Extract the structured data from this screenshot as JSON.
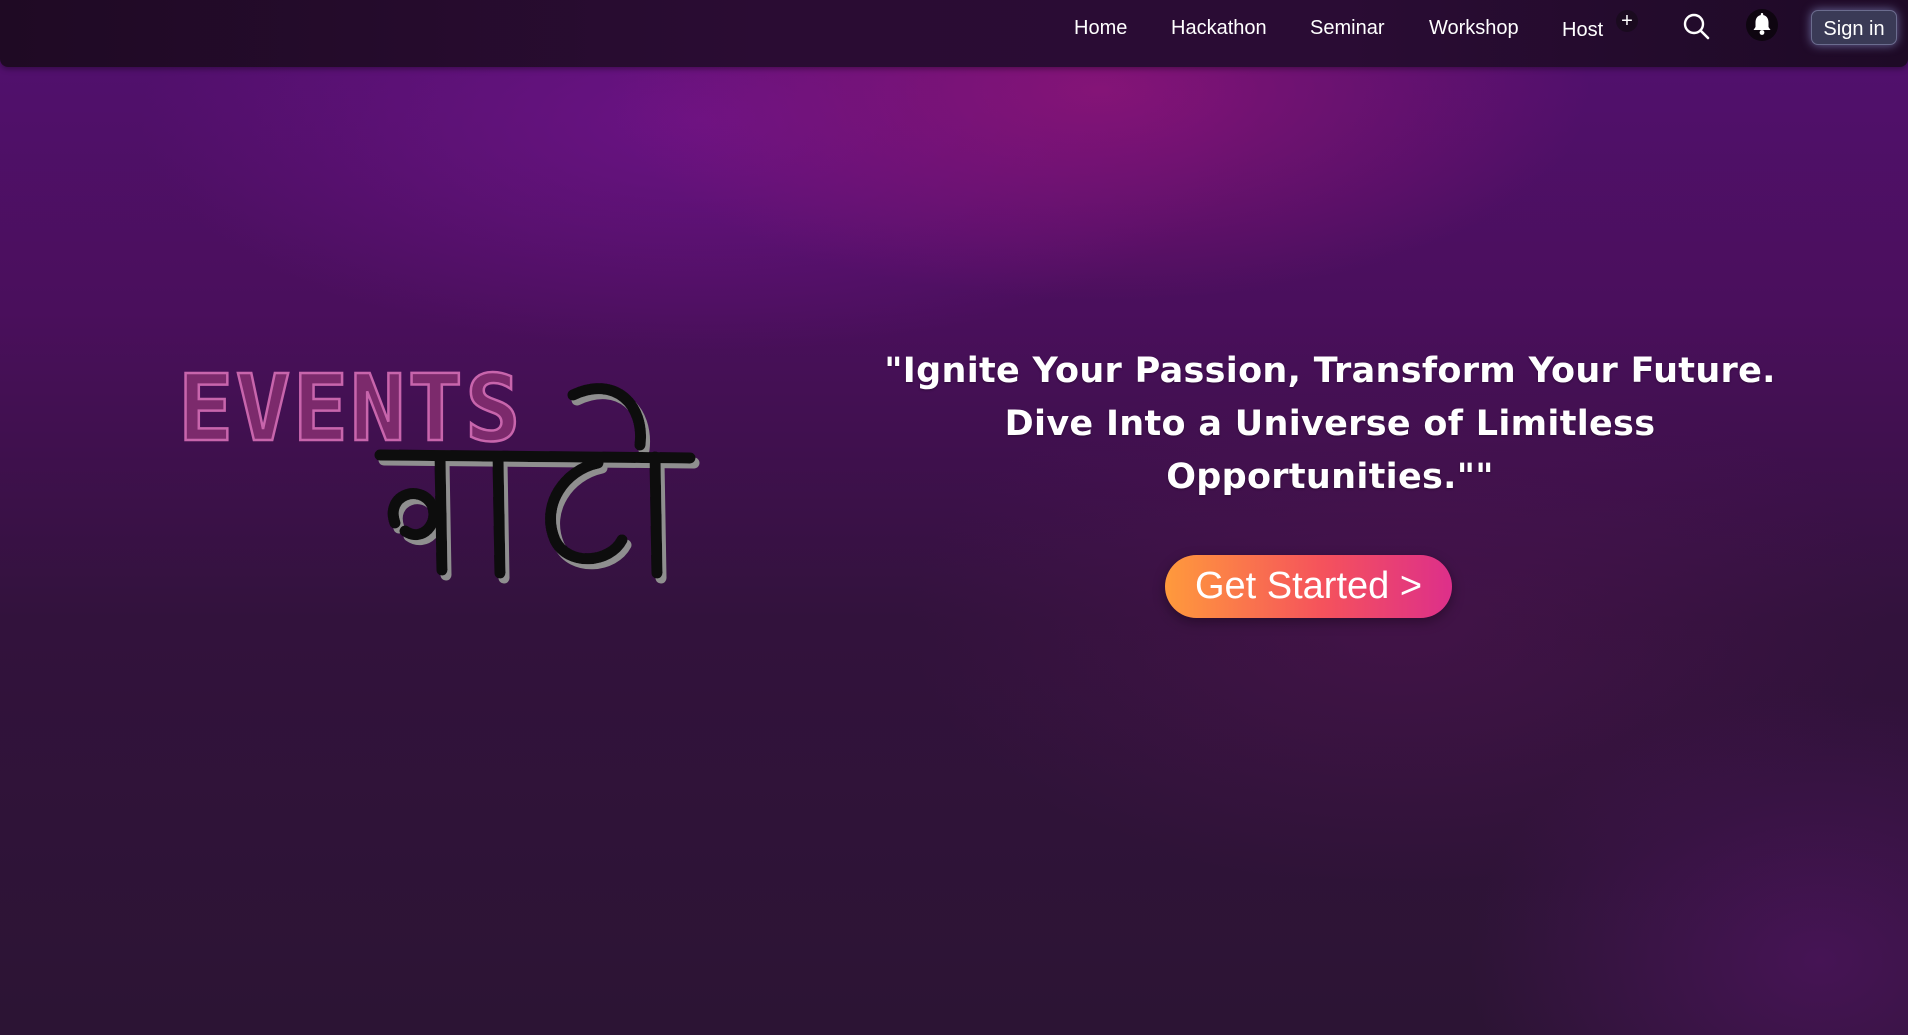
{
  "nav": {
    "links": [
      "Home",
      "Hackathon",
      "Seminar",
      "Workshop",
      "Host"
    ],
    "host_plus": "+",
    "search_icon": "search-icon",
    "bell_icon": "bell-icon",
    "signin_label": "Sign in"
  },
  "logo": {
    "line1": "EVENTS",
    "line2": "वाले",
    "color_events": "#a8488f",
    "color_script": "#0b0b0b"
  },
  "hero": {
    "tagline_line1": "\"Ignite Your Passion, Transform Your Future.",
    "tagline_line2": "Dive Into a Universe of Limitless",
    "tagline_line3": "Opportunities.\"\"",
    "cta_label": "Get Started >"
  },
  "colors": {
    "cta_gradient": [
      "#ff9a3c",
      "#f5525c",
      "#dd2f8a"
    ],
    "navbar": "#2a0c33",
    "signin_bg": "#3a3a56"
  }
}
